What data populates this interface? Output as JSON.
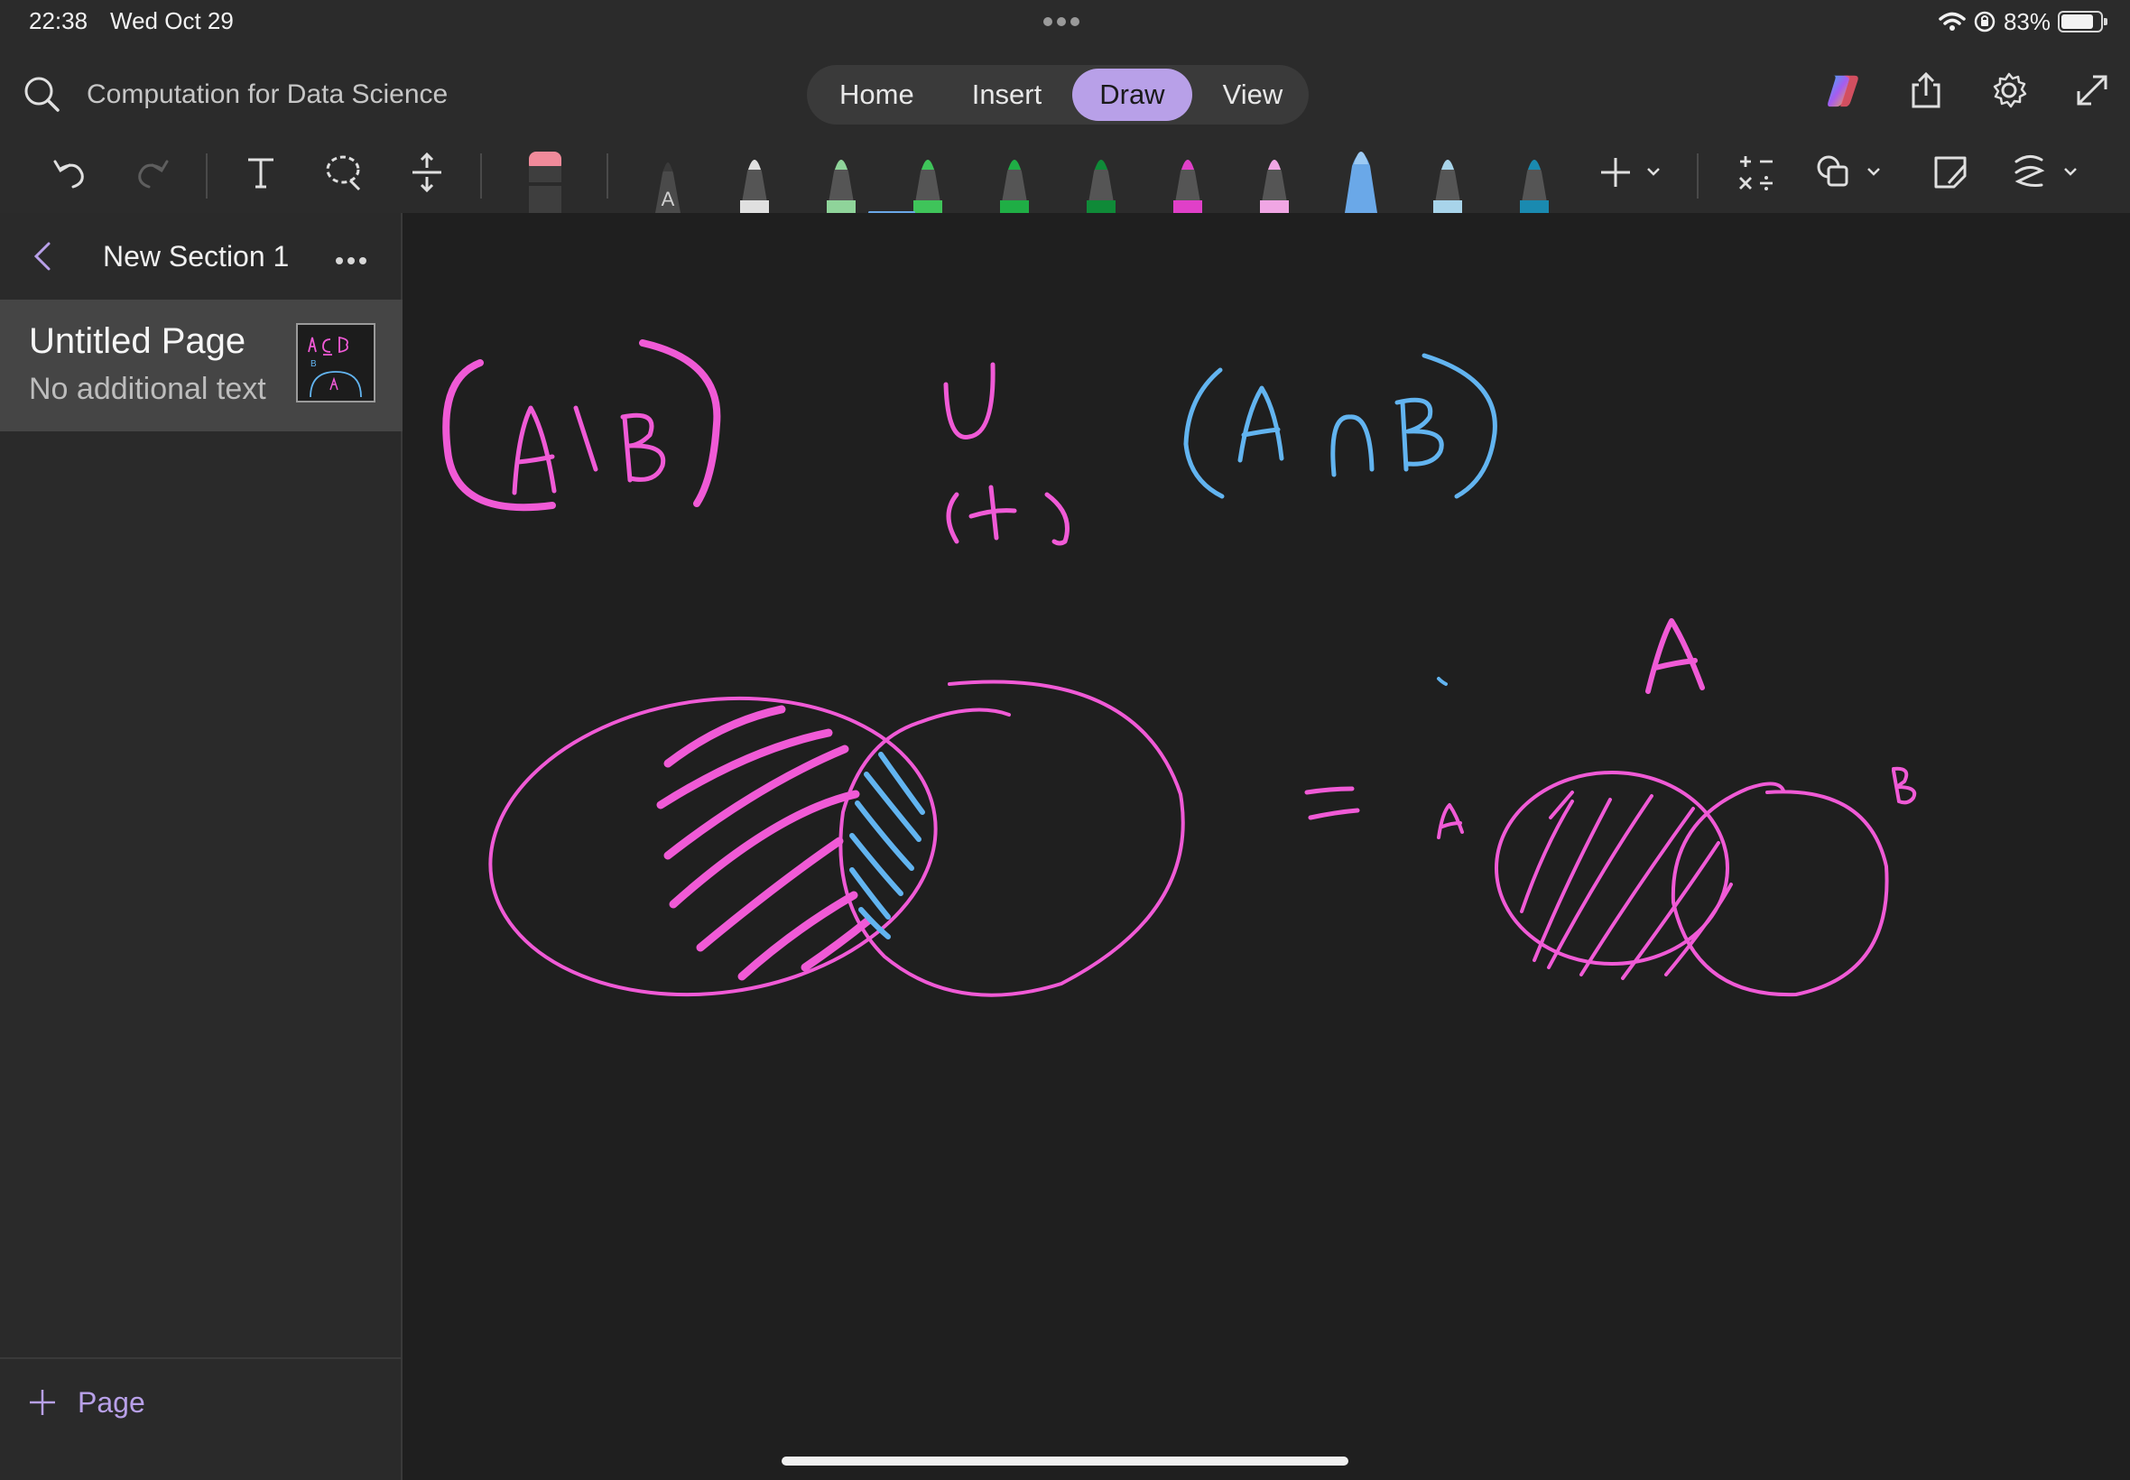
{
  "status": {
    "time": "22:38",
    "date": "Wed Oct 29",
    "battery": "83%"
  },
  "app": {
    "notebook_title": "Computation for Data Science",
    "tabs": [
      {
        "label": "Home",
        "active": false
      },
      {
        "label": "Insert",
        "active": false
      },
      {
        "label": "Draw",
        "active": true
      },
      {
        "label": "View",
        "active": false
      }
    ]
  },
  "toolbar": {
    "icons": [
      "undo-icon",
      "redo-icon",
      "text-icon",
      "lasso-icon",
      "add-space-icon",
      "eraser-icon",
      "add-pen-icon",
      "math-icon",
      "shapes-icon",
      "ink-to-shape-icon",
      "ruler-icon"
    ],
    "pens": [
      {
        "name": "pen-text",
        "color": "#3a3a3a",
        "label": "A"
      },
      {
        "name": "pen-white",
        "color": "#e0e0e0",
        "label": ""
      },
      {
        "name": "pen-light-green",
        "color": "#8fd49a",
        "label": ""
      },
      {
        "name": "pen-green",
        "color": "#3fc45a",
        "label": ""
      },
      {
        "name": "pen-mid-green",
        "color": "#1fae45",
        "label": ""
      },
      {
        "name": "pen-dark-green",
        "color": "#0f8a38",
        "label": ""
      },
      {
        "name": "pen-magenta",
        "color": "#e040c8",
        "label": ""
      },
      {
        "name": "pen-pink",
        "color": "#f0a6e4",
        "label": ""
      },
      {
        "name": "pen-blue-highlighter",
        "color": "#6aa8e8",
        "label": ""
      },
      {
        "name": "pen-light-blue",
        "color": "#a8d4ea",
        "label": ""
      },
      {
        "name": "pen-teal",
        "color": "#1a8ab0",
        "label": ""
      }
    ]
  },
  "sidebar": {
    "section_title": "New Section 1",
    "pages": [
      {
        "title": "Untitled Page",
        "subtitle": "No additional text"
      }
    ],
    "add_page_label": "Page"
  },
  "ink_colors": {
    "pink": "#f05ad6",
    "blue": "#62b4f0"
  }
}
